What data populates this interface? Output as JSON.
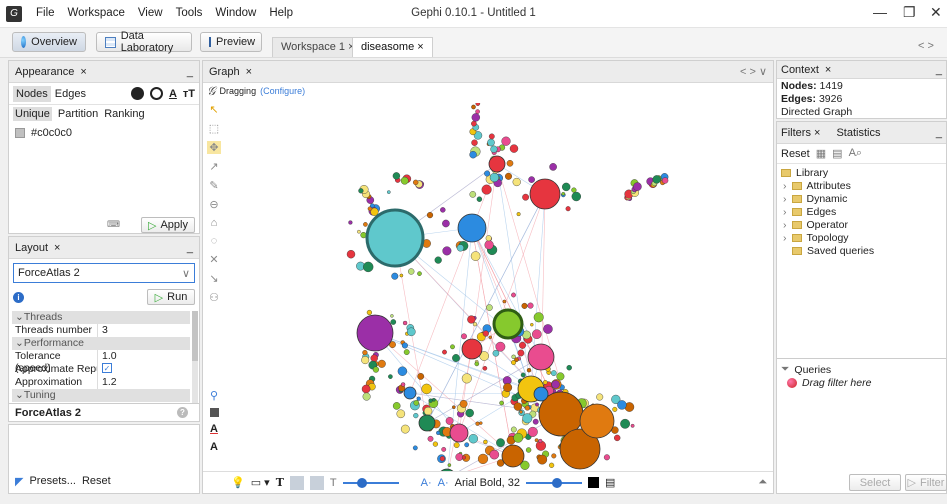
{
  "app": {
    "logo_text": "G",
    "menu": [
      "File",
      "Workspace",
      "View",
      "Tools",
      "Window",
      "Help"
    ],
    "window_title": "Gephi 0.10.1 - Untitled 1",
    "controls": {
      "min": "—",
      "max": "❐",
      "close": "✕"
    }
  },
  "toolbar": {
    "overview": "Overview",
    "data_lab": "Data Laboratory",
    "preview": "Preview",
    "workspaces": [
      {
        "label": "Workspace 1",
        "close": "×"
      },
      {
        "label": "diseasome",
        "close": "×"
      }
    ],
    "nav_arrows": "< >"
  },
  "appearance": {
    "title": "Appearance",
    "close": "×",
    "minimize": "_",
    "tabs": [
      "Nodes",
      "Edges"
    ],
    "subtabs": [
      "Unique",
      "Partition",
      "Ranking"
    ],
    "color_value": "#c0c0c0",
    "apply": "Apply"
  },
  "layout": {
    "title": "Layout",
    "close": "×",
    "minimize": "_",
    "algorithm": "ForceAtlas 2",
    "run": "Run",
    "props": [
      {
        "type": "section",
        "label": "Threads"
      },
      {
        "type": "prop",
        "label": "Threads number",
        "value": "3"
      },
      {
        "type": "section",
        "label": "Performance"
      },
      {
        "type": "prop",
        "label": "Tolerance (speed)",
        "value": "1.0"
      },
      {
        "type": "prop",
        "label": "Approximate Repulsic",
        "value": "✓"
      },
      {
        "type": "prop",
        "label": "Approximation",
        "value": "1.2"
      },
      {
        "type": "section",
        "label": "Tuning"
      }
    ],
    "desc_title": "ForceAtlas 2",
    "presets": "Presets...",
    "reset": "Reset"
  },
  "graph": {
    "title": "Graph",
    "close": "×",
    "mode_label": "Dragging",
    "configure": "(Configure)",
    "font_label": "Arial Bold, 32",
    "nav": "< > ∨"
  },
  "context": {
    "title": "Context",
    "close": "×",
    "minimize": "_",
    "nodes_label": "Nodes:",
    "nodes_value": "1419",
    "edges_label": "Edges:",
    "edges_value": "3926",
    "graph_type": "Directed Graph"
  },
  "filters": {
    "title": "Filters",
    "close": "×",
    "statistics_tab": "Statistics",
    "minimize": "_",
    "reset": "Reset",
    "library": "Library",
    "items": [
      "Attributes",
      "Dynamic",
      "Edges",
      "Operator",
      "Topology"
    ],
    "saved": "Saved queries",
    "queries": "Queries",
    "drag_hint": "Drag filter here",
    "select": "Select",
    "filter": "Filter"
  },
  "colors": {
    "accent": "#3b7dd8",
    "green": "#3bab3b",
    "selected_panel": "#c0c0c0"
  }
}
